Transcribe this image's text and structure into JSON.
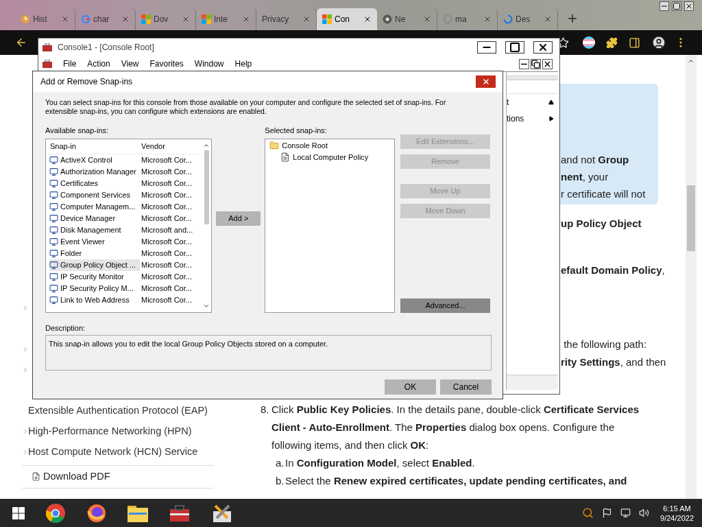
{
  "browser": {
    "tabs": [
      {
        "label": "Hist",
        "kind": "history",
        "selected": false
      },
      {
        "label": "char",
        "kind": "google",
        "selected": false
      },
      {
        "label": "Dov",
        "kind": "microsoft",
        "selected": false
      },
      {
        "label": "Inte",
        "kind": "microsoft",
        "selected": false
      },
      {
        "label": "Privacy",
        "kind": "plain",
        "selected": false
      },
      {
        "label": "Con",
        "kind": "microsoft",
        "selected": true
      },
      {
        "label": "Ne",
        "kind": "chrome",
        "selected": false
      },
      {
        "label": "ma",
        "kind": "circle",
        "selected": false
      },
      {
        "label": "Des",
        "kind": "spinner",
        "selected": false
      }
    ]
  },
  "page": {
    "nav": {
      "items": [
        {
          "expandable": true
        },
        {
          "expandable": false
        },
        {
          "expandable": true
        },
        {
          "expandable": true
        },
        {
          "expandable": false
        },
        {
          "label": "Extensible Authentication Protocol (EAP)",
          "expandable": false
        },
        {
          "label": "High-Performance Networking (HPN)",
          "expandable": true
        },
        {
          "label": "Host Compute Network (HCN) Service",
          "expandable": true
        }
      ],
      "download": "Download PDF"
    },
    "note": [
      "and not **Group**",
      "**nent**, your",
      "r certificate will not"
    ],
    "fragments": [
      {
        "text": "up Policy Object",
        "bold": true
      },
      {
        "text": "**efault Domain Policy**,",
        "bold": false
      },
      {
        "text": " the following path:",
        "bold": false
      },
      {
        "text": "**rity Settings**, and then",
        "bold": false
      }
    ],
    "step": {
      "number": "8.",
      "text": "Click **Public Key Policies**. In the details pane, double-click **Certificate Services Client - Auto-Enrollment**. The **Properties** dialog box opens. Configure the following items, and then click **OK**:",
      "subitems": [
        {
          "marker": "a.",
          "text": "In **Configuration Model**, select **Enabled**."
        },
        {
          "marker": "b.",
          "text": "Select the **Renew expired certificates, update pending certificates, and**"
        }
      ]
    }
  },
  "console": {
    "title": "Console1 - [Console Root]",
    "menu": [
      "File",
      "Action",
      "View",
      "Favorites",
      "Window",
      "Help"
    ],
    "actions": [
      {
        "label": "t",
        "has_submenu": false
      },
      {
        "label": "tions",
        "has_submenu": true
      }
    ]
  },
  "dialog": {
    "title": "Add or Remove Snap-ins",
    "intro": "You can select snap-ins for this console from those available on your computer and configure the selected set of snap-ins. For extensible snap-ins, you can configure which extensions are enabled.",
    "available_label": "Available snap-ins:",
    "columns": [
      "Snap-in",
      "Vendor"
    ],
    "snapins": [
      {
        "name": "ActiveX Control",
        "vendor": "Microsoft Cor...",
        "selected": false
      },
      {
        "name": "Authorization Manager",
        "vendor": "Microsoft Cor...",
        "selected": false
      },
      {
        "name": "Certificates",
        "vendor": "Microsoft Cor...",
        "selected": false
      },
      {
        "name": "Component Services",
        "vendor": "Microsoft Cor...",
        "selected": false
      },
      {
        "name": "Computer Managem...",
        "vendor": "Microsoft Cor...",
        "selected": false
      },
      {
        "name": "Device Manager",
        "vendor": "Microsoft Cor...",
        "selected": false
      },
      {
        "name": "Disk Management",
        "vendor": "Microsoft and...",
        "selected": false
      },
      {
        "name": "Event Viewer",
        "vendor": "Microsoft Cor...",
        "selected": false
      },
      {
        "name": "Folder",
        "vendor": "Microsoft Cor...",
        "selected": false
      },
      {
        "name": "Group Policy Object ...",
        "vendor": "Microsoft Cor...",
        "selected": true
      },
      {
        "name": "IP Security Monitor",
        "vendor": "Microsoft Cor...",
        "selected": false
      },
      {
        "name": "IP Security Policy M...",
        "vendor": "Microsoft Cor...",
        "selected": false
      },
      {
        "name": "Link to Web Address",
        "vendor": "Microsoft Cor...",
        "selected": false
      }
    ],
    "add_button": "Add >",
    "selected_label": "Selected snap-ins:",
    "tree": [
      {
        "label": "Console Root",
        "children": [
          {
            "label": "Local Computer Policy"
          }
        ]
      }
    ],
    "side_buttons": [
      {
        "label": "Edit Extensions...",
        "disabled": true
      },
      {
        "label": "Remove",
        "disabled": true
      },
      {
        "label": "Move Up",
        "disabled": true
      },
      {
        "label": "Move Down",
        "disabled": true
      },
      {
        "label": "Advanced...",
        "disabled": false
      }
    ],
    "description_label": "Description:",
    "description": "This snap-in allows you to edit the local Group Policy Objects stored on a computer.",
    "ok": "OK",
    "cancel": "Cancel"
  },
  "taskbar": {
    "apps": [
      {
        "kind": "chrome"
      },
      {
        "kind": "firefox"
      },
      {
        "kind": "explorer"
      },
      {
        "kind": "toolbox"
      },
      {
        "kind": "tool"
      }
    ],
    "time": "6:15 AM",
    "date": "9/24/2022"
  }
}
